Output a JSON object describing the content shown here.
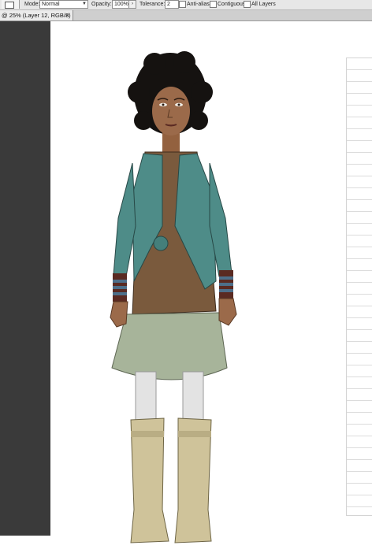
{
  "options_bar": {
    "mode_label": "Mode:",
    "mode_value": "Normal",
    "opacity_label": "Opacity:",
    "opacity_value": "100%",
    "tolerance_label": "Tolerance:",
    "tolerance_value": "2",
    "anti_alias_label": "Anti-alias",
    "contiguous_label": "Contiguous",
    "all_layers_label": "All Layers"
  },
  "document_tab": {
    "title": "@ 25% (Layer 12, RGB/8)",
    "close_glyph": "×"
  },
  "colors": {
    "pasteboard": "#3a3a3a",
    "skin": "#9b6a4a",
    "hair": "#151210",
    "cardigan": "#4e8c88",
    "dress": "#7a5a3d",
    "skirt": "#a7b49a",
    "leggings": "#e3e3e3",
    "boots": "#cfc39a",
    "wristband_dark": "#5a2a22",
    "wristband_blue": "#4d6f8a"
  }
}
